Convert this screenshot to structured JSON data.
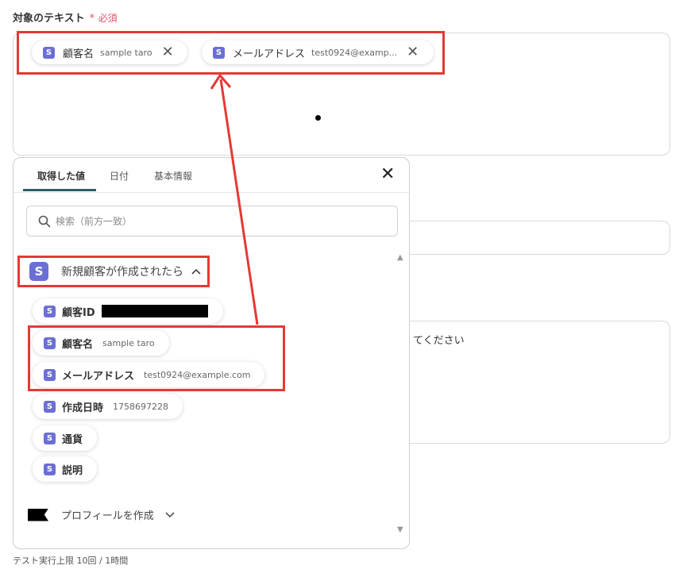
{
  "field": {
    "label": "対象のテキスト",
    "required_star": "*",
    "required_text": "必須"
  },
  "selected_chips": [
    {
      "icon": "S",
      "label": "顧客名",
      "value": "sample taro",
      "close": "✕"
    },
    {
      "icon": "S",
      "label": "メールアドレス",
      "value": "test0924@examp...",
      "close": "✕"
    }
  ],
  "background": {
    "textarea_partial_text": "てください"
  },
  "popup": {
    "tabs": [
      {
        "label": "取得した値",
        "active": true
      },
      {
        "label": "日付",
        "active": false
      },
      {
        "label": "基本情報",
        "active": false
      }
    ],
    "close": "✕",
    "search_placeholder": "検索（前方一致）",
    "section": {
      "icon": "S",
      "title": "新規顧客が作成されたら",
      "chevron": "^"
    },
    "items": [
      {
        "icon": "S",
        "label": "顧客ID",
        "value": "",
        "redacted": true
      },
      {
        "icon": "S",
        "label": "顧客名",
        "value": "sample taro"
      },
      {
        "icon": "S",
        "label": "メールアドレス",
        "value": "test0924@example.com"
      },
      {
        "icon": "S",
        "label": "作成日時",
        "value": "1758697228"
      },
      {
        "icon": "S",
        "label": "通貨",
        "value": ""
      },
      {
        "icon": "S",
        "label": "説明",
        "value": ""
      }
    ],
    "profile_section": {
      "label": "プロフィールを作成",
      "chevron": "⌄"
    },
    "scroll_up": "▲",
    "scroll_down": "▼"
  },
  "footer": {
    "text": "テスト実行上限 10回 / 1時間"
  },
  "colors": {
    "accent_red": "#e53935",
    "icon_purple": "#6b6fd4",
    "required_pink": "#e0506a",
    "tab_underline": "#2f5d6b"
  }
}
